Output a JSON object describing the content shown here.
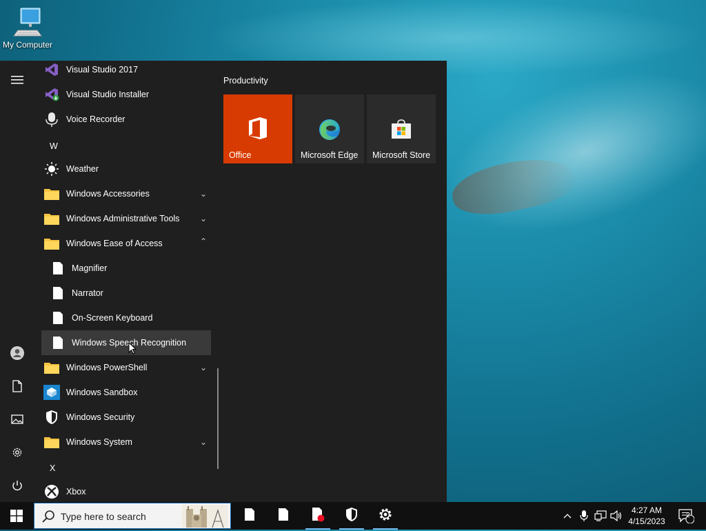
{
  "desktop": {
    "icon_label": "My Computer"
  },
  "start_menu": {
    "app_list": [
      {
        "label": "Visual Studio 2017",
        "icon": "visual-studio-icon"
      },
      {
        "label": "Visual Studio Installer",
        "icon": "visual-studio-installer-icon"
      },
      {
        "label": "Voice Recorder",
        "icon": "microphone-icon"
      },
      {
        "letter": "W"
      },
      {
        "label": "Weather",
        "icon": "sun-icon"
      },
      {
        "label": "Windows Accessories",
        "icon": "folder-icon",
        "expandable": true
      },
      {
        "label": "Windows Administrative Tools",
        "icon": "folder-icon",
        "expandable": true
      },
      {
        "label": "Windows Ease of Access",
        "icon": "folder-icon",
        "expanded": true
      },
      {
        "label": "Magnifier",
        "icon": "file-icon"
      },
      {
        "label": "Narrator",
        "icon": "file-icon"
      },
      {
        "label": "On-Screen Keyboard",
        "icon": "file-icon"
      },
      {
        "label": "Windows Speech Recognition",
        "icon": "file-icon",
        "hovered": true
      },
      {
        "label": "Windows PowerShell",
        "icon": "folder-icon",
        "expandable": true
      },
      {
        "label": "Windows Sandbox",
        "icon": "sandbox-icon"
      },
      {
        "label": "Windows Security",
        "icon": "shield-icon"
      },
      {
        "label": "Windows System",
        "icon": "folder-icon",
        "expandable": true
      },
      {
        "letter": "X"
      },
      {
        "label": "Xbox",
        "icon": "xbox-icon"
      }
    ],
    "group_title": "Productivity",
    "tiles": [
      {
        "label": "Office",
        "color": "#d83b01"
      },
      {
        "label": "Microsoft Edge",
        "color": "#2b2b2b"
      },
      {
        "label": "Microsoft Store",
        "color": "#2b2b2b"
      }
    ]
  },
  "taskbar": {
    "search_placeholder": "Type here to search",
    "clock_time": "4:27 AM",
    "clock_date": "4/15/2023",
    "notification_count": "2"
  },
  "colors": {
    "accent": "#0078d7",
    "office": "#d83b01",
    "menu_bg": "#1f1f1f",
    "taskbar_bg": "#101010"
  }
}
